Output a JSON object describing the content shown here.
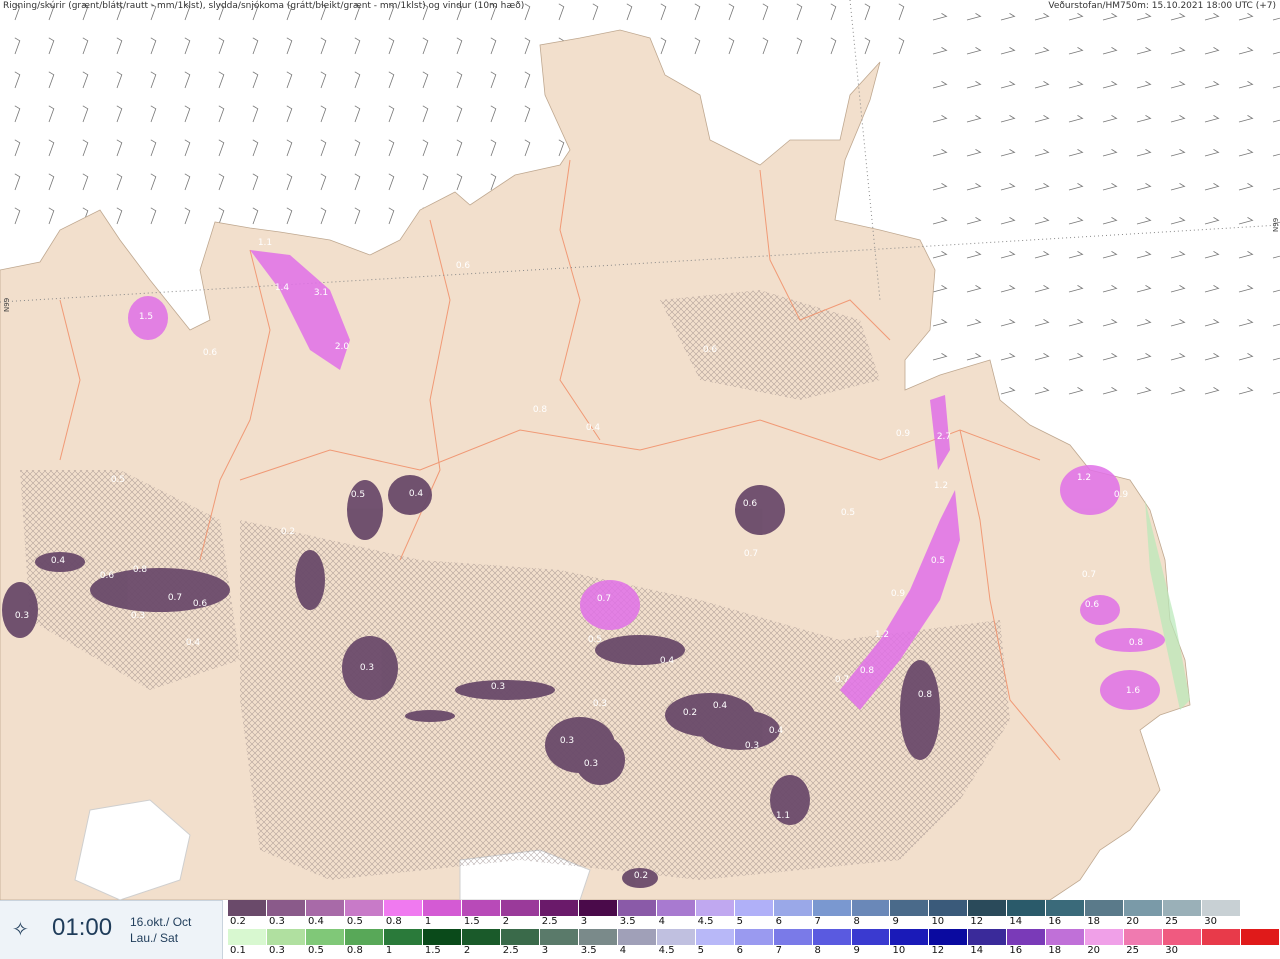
{
  "header": {
    "left_text": "Rigning/skúrir (grænt/blátt/rautt - mm/1klst), slydda/snjókoma (grátt/bleikt/grænt - mm/1klst) og vindur (10m hæð)",
    "right_text": "Veðurstofan/HM750m: 15.10.2021 18:00 UTC (+7)"
  },
  "latitude_labels": [
    "N99",
    "N99"
  ],
  "time_panel": {
    "icon": "compass-star-icon",
    "time": "01:00",
    "date_line1": "16.okt./ Oct",
    "date_line2": "Lau./ Sat"
  },
  "legend": {
    "precip_colors": [
      "#6a4a6a",
      "#8a5a8a",
      "#a86aa8",
      "#c87ac8",
      "#f07af0",
      "#d45ad4",
      "#b84ab8",
      "#9a3a9a",
      "#6a1a6a",
      "#4a0a4a",
      "#8a5aa8",
      "#a87ad0",
      "#c0a8f0",
      "#b0b0f8",
      "#9aa8e8",
      "#7a98d0",
      "#6a88b8",
      "#4a6a8a",
      "#3a5a7a",
      "#2a4a5a",
      "#2a5a6a",
      "#3a6a7a",
      "#5a7a8a",
      "#7a9aa8",
      "#9ab0b8",
      "#c8d0d4",
      "#ffffff"
    ],
    "precip_labels": [
      "0.2",
      "0.3",
      "0.4",
      "0.5",
      "0.8",
      "1",
      "1.5",
      "2",
      "2.5",
      "3",
      "3.5",
      "4",
      "4.5",
      "5",
      "6",
      "7",
      "8",
      "9",
      "10",
      "12",
      "14",
      "16",
      "18",
      "20",
      "25",
      "30",
      ""
    ],
    "snow_colors": [
      "#d8f8d0",
      "#b0e0a0",
      "#80c878",
      "#58a858",
      "#2a7a3a",
      "#0a4a1a",
      "#1a5a2a",
      "#3a6a4a",
      "#5a7a6a",
      "#7a8a8a",
      "#a0a0b8",
      "#c0c0e0",
      "#b8b8f8",
      "#9a9af0",
      "#7a7ae8",
      "#5a5ae0",
      "#3a3ad0",
      "#1a1ab8",
      "#0a0aa0",
      "#3a2a9a",
      "#7a3ab8",
      "#c070d8",
      "#f0a0e8",
      "#f07ab0",
      "#f05a80",
      "#e83a4a",
      "#e01a1a"
    ],
    "snow_labels": [
      "0.1",
      "0.3",
      "0.5",
      "0.8",
      "1",
      "1.5",
      "2",
      "2.5",
      "3",
      "3.5",
      "4",
      "4.5",
      "5",
      "6",
      "7",
      "8",
      "9",
      "10",
      "12",
      "14",
      "16",
      "18",
      "20",
      "25",
      "30",
      "",
      ""
    ]
  },
  "precip_labels": [
    "1.5",
    "0.6",
    "3.1",
    "2.0",
    "1.1",
    "1.4",
    "0.6",
    "0.8",
    "0.6",
    "0.4",
    "0.5",
    "0.4",
    "0.5",
    "0.4",
    "0.6",
    "0.8",
    "0.7",
    "0.6",
    "0.3",
    "0.4",
    "0.3",
    "0.2",
    "0.7",
    "0.5",
    "0.3",
    "0.3",
    "0.3",
    "0.3",
    "0.3",
    "0.4",
    "0.4",
    "0.9",
    "2.7",
    "1.2",
    "0.8",
    "0.5",
    "0.9",
    "1.2",
    "0.7",
    "0.8",
    "1.1",
    "0.2",
    "0.3",
    "0.4",
    "0.6",
    "0.7",
    "0.5",
    "1.2",
    "0.9",
    "0.7",
    "1.6",
    "0.8",
    "0.6",
    "0.2"
  ],
  "colors": {
    "land": "#f2dfcc",
    "sea": "#ffffff",
    "roads": "#f08860",
    "precip_light": "#6a4a6a",
    "precip_heavy": "#e070e8"
  }
}
